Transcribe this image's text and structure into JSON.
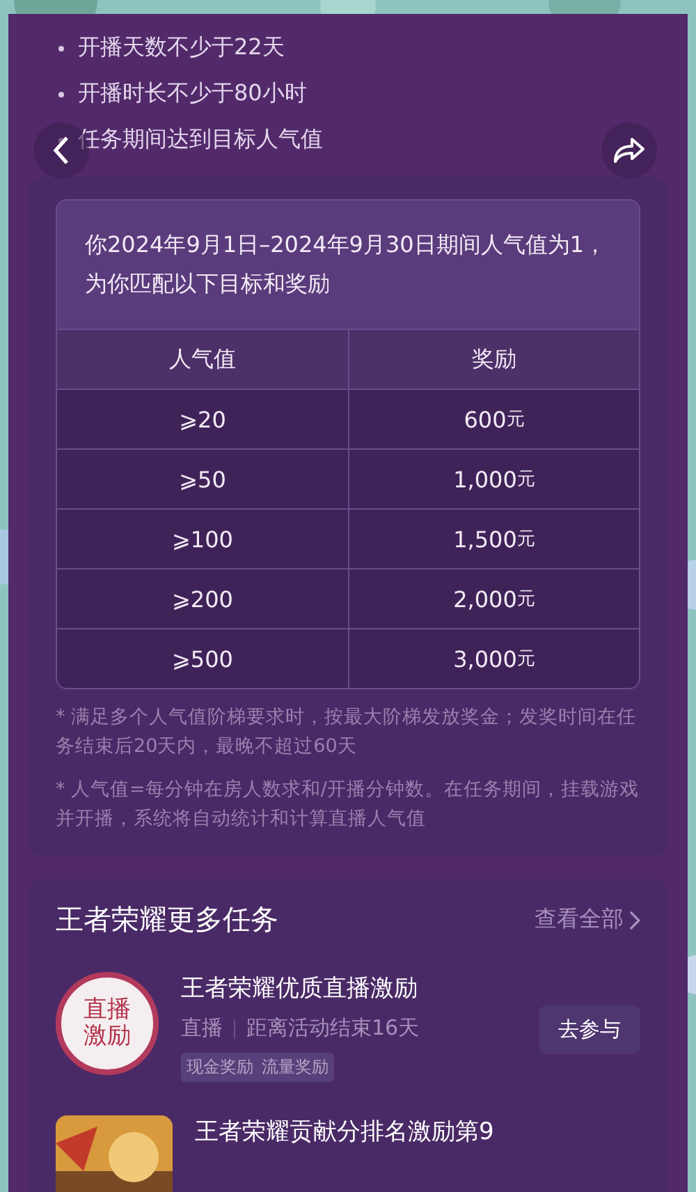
{
  "requirements": [
    "开播天数不少于22天",
    "开播时长不少于80小时",
    "任务期间达到目标人气值"
  ],
  "target_card": {
    "intro": "你2024年9月1日–2024年9月30日期间人气值为1，为你匹配以下目标和奖励",
    "columns": [
      "人气值",
      "奖励"
    ],
    "rows": [
      {
        "threshold": "⩾20",
        "amount": "600",
        "unit": "元"
      },
      {
        "threshold": "⩾50",
        "amount": "1,000",
        "unit": "元"
      },
      {
        "threshold": "⩾100",
        "amount": "1,500",
        "unit": "元"
      },
      {
        "threshold": "⩾200",
        "amount": "2,000",
        "unit": "元"
      },
      {
        "threshold": "⩾500",
        "amount": "3,000",
        "unit": "元"
      }
    ]
  },
  "notes": [
    "* 满足多个人气值阶梯要求时，按最大阶梯发放奖金；发奖时间在任务结束后20天内，最晚不超过60天",
    "* 人气值=每分钟在房人数求和/开播分钟数。在任务期间，挂载游戏并开播，系统将自动统计和计算直播人气值"
  ],
  "more_tasks": {
    "title": "王者荣耀更多任务",
    "view_all": "查看全部",
    "items": [
      {
        "kind": "badge",
        "badge_text": "直播激励",
        "title": "王者荣耀优质直播激励",
        "category": "直播",
        "remaining": "距离活动结束16天",
        "tags": [
          "现金奖励",
          "流量奖励"
        ],
        "action": "去参与"
      },
      {
        "kind": "picture",
        "title": "王者荣耀贡献分排名激励第9"
      }
    ]
  }
}
